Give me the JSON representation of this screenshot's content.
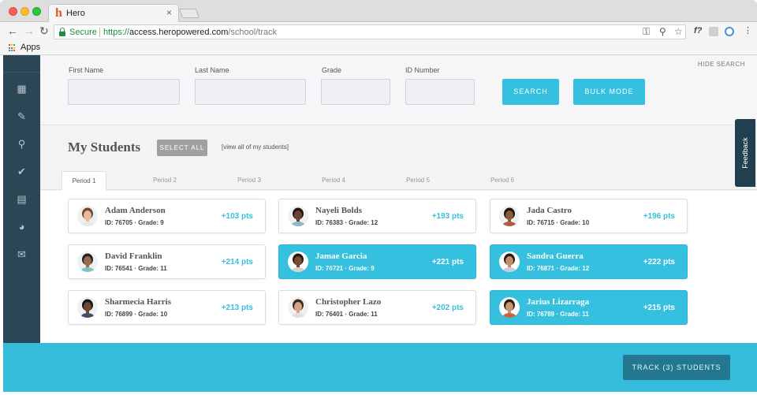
{
  "browser": {
    "tab_title": "Hero",
    "favicon_letter": "h",
    "tab_close_glyph": "×",
    "back_glyph": "←",
    "forward_glyph": "→",
    "reload_glyph": "↻",
    "secure_label": "Secure",
    "url_protocol": "https://",
    "url_host": "access.heropowered.com",
    "url_path": "/school/track",
    "key_icon": "key-icon",
    "zoom_icon": "magnifier-icon",
    "star_icon": "star-icon",
    "ext_f_label": "f?",
    "menu_glyph": "⋮",
    "bookmarks_apps_label": "Apps",
    "apps_colors": [
      "#ea4335",
      "#fbbc05",
      "#34a853",
      "#4285f4",
      "#ea4335",
      "#fbbc05",
      "#34a853",
      "#4285f4",
      "#ea4335"
    ]
  },
  "sidebar": {
    "items": [
      {
        "icon": "calendar-grid-icon",
        "glyph": "▦"
      },
      {
        "icon": "badge-icon",
        "glyph": "✎"
      },
      {
        "icon": "search-icon",
        "glyph": "⚲"
      },
      {
        "icon": "check-icon",
        "glyph": "✔"
      },
      {
        "icon": "calendar-icon",
        "glyph": "▤"
      },
      {
        "icon": "pie-chart-icon",
        "glyph": "◕"
      },
      {
        "icon": "mail-icon",
        "glyph": "✉"
      }
    ]
  },
  "search": {
    "hide_label": "HIDE SEARCH",
    "first_name_label": "First Name",
    "last_name_label": "Last Name",
    "grade_label": "Grade",
    "id_label": "ID Number",
    "first_name_value": "",
    "last_name_value": "",
    "grade_value": "",
    "id_value": "",
    "search_button": "SEARCH",
    "bulk_button": "BULK MODE"
  },
  "students_section": {
    "title": "My Students",
    "select_all": "SELECT ALL",
    "view_all": "[view all of my students]",
    "periods": [
      "Period 1",
      "Period 2",
      "Period 3",
      "Period 4",
      "Period 5",
      "Period 6"
    ],
    "active_period": "Period 1"
  },
  "students": [
    {
      "name": "Adam Anderson",
      "meta": "ID: 76705 · Grade: 9",
      "points": "+103 pts",
      "selected": false
    },
    {
      "name": "Nayeli Bolds",
      "meta": "ID: 76383 · Grade: 12",
      "points": "+193 pts",
      "selected": false
    },
    {
      "name": "Jada Castro",
      "meta": "ID: 76715 · Grade: 10",
      "points": "+196 pts",
      "selected": false
    },
    {
      "name": "David Franklin",
      "meta": "ID: 76541 · Grade: 11",
      "points": "+214 pts",
      "selected": false
    },
    {
      "name": "Jamae Garcia",
      "meta": "ID: 76721 · Grade: 9",
      "points": "+221 pts",
      "selected": true
    },
    {
      "name": "Sandra Guerra",
      "meta": "ID: 76871 · Grade: 12",
      "points": "+222 pts",
      "selected": true
    },
    {
      "name": "Sharmecia Harris",
      "meta": "ID: 76899 · Grade: 10",
      "points": "+213 pts",
      "selected": false
    },
    {
      "name": "Christopher Lazo",
      "meta": "ID: 76401 · Grade: 11",
      "points": "+202 pts",
      "selected": false
    },
    {
      "name": "Jarius Lizarraga",
      "meta": "ID: 76789 · Grade: 11",
      "points": "+215 pts",
      "selected": true
    }
  ],
  "footer": {
    "track_button": "TRACK (3) STUDENTS"
  },
  "feedback_tab": "Feedback",
  "colors": {
    "accent": "#35c0df",
    "sidebar": "#2b4654",
    "track_button": "#23788f",
    "feedback": "#213f4e"
  }
}
